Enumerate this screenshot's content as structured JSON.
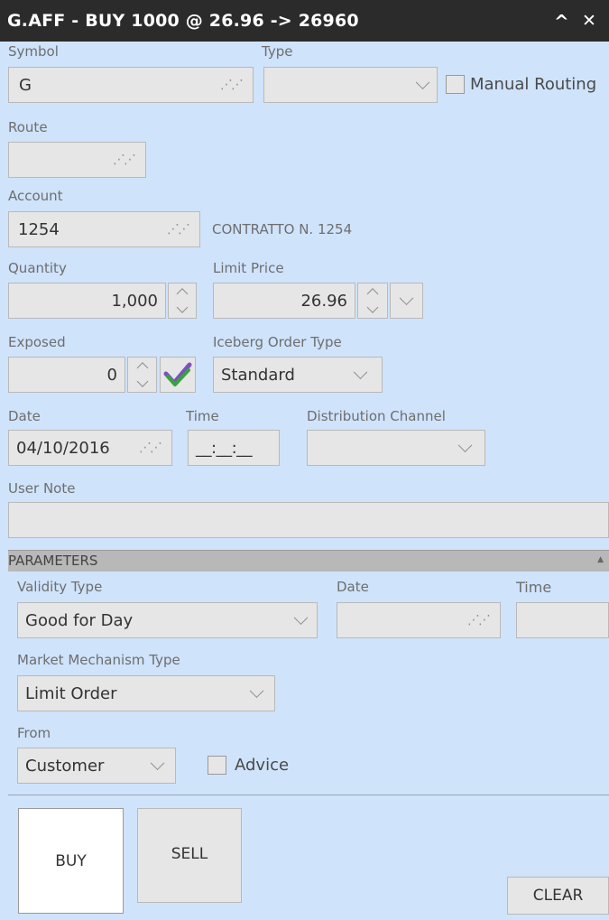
{
  "window": {
    "title": "G.AFF - BUY 1000 @ 26.96 -> 26960",
    "collapse_icon": "^",
    "close_icon": "✕"
  },
  "order": {
    "symbol_label": "Symbol",
    "symbol_value": "G",
    "type_label": "Type",
    "type_value": "",
    "manual_routing_label": "Manual Routing",
    "route_label": "Route",
    "route_value": "",
    "account_label": "Account",
    "account_value": "1254",
    "account_description": "CONTRATTO N. 1254",
    "quantity_label": "Quantity",
    "quantity_value": "1,000",
    "limit_price_label": "Limit Price",
    "limit_price_value": "26.96",
    "exposed_label": "Exposed",
    "exposed_value": "0",
    "iceberg_label": "Iceberg Order Type",
    "iceberg_value": "Standard",
    "date_label": "Date",
    "date_value": "04/10/2016",
    "time_label": "Time",
    "time_value": "__:__:__",
    "distribution_label": "Distribution Channel",
    "distribution_value": "",
    "user_note_label": "User Note",
    "user_note_value": ""
  },
  "parameters": {
    "header": "PARAMETERS",
    "collapse_icon": "▲",
    "validity_type_label": "Validity Type",
    "validity_type_value": "Good for Day",
    "date_label": "Date",
    "date_value": "",
    "time_label": "Time",
    "time_value": "",
    "market_mechanism_label": "Market Mechanism Type",
    "market_mechanism_value": "Limit Order",
    "from_label": "From",
    "from_value": "Customer",
    "advice_label": "Advice"
  },
  "actions": {
    "buy_label": "BUY",
    "sell_label": "SELL",
    "clear_label": "CLEAR"
  },
  "colors": {
    "background": "#cfe3fb",
    "titlebar": "#2b2b2b",
    "field": "#e6e6e6",
    "section_header": "#b8b8b8",
    "check_green": "#3aa33a",
    "check_purple": "#7b4fc9"
  },
  "icons": {
    "grip": "grip-icon",
    "spinner": "spinner-icon",
    "dropdown": "chevron-down-icon",
    "confirm": "check-icon"
  }
}
